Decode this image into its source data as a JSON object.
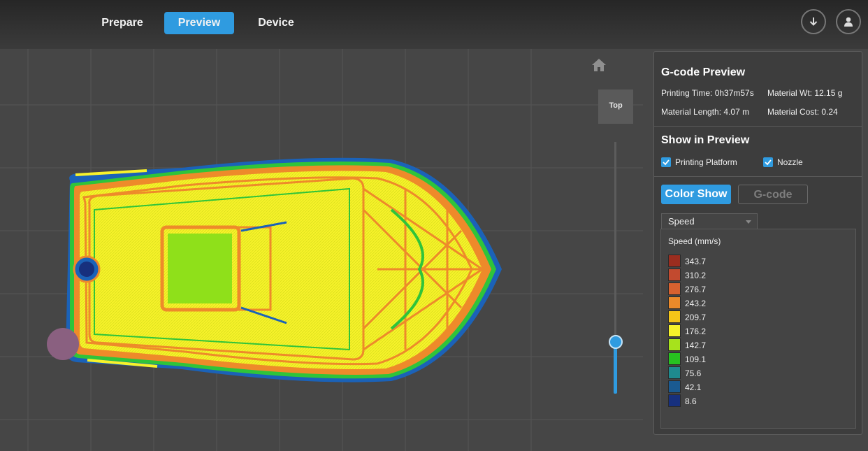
{
  "nav": {
    "tabs": [
      {
        "label": "Prepare",
        "active": false
      },
      {
        "label": "Preview",
        "active": true
      },
      {
        "label": "Device",
        "active": false
      }
    ],
    "accent": "#2f9be0"
  },
  "view": {
    "cube_label": "Top",
    "layer_slider": 0.2
  },
  "panel": {
    "title": "G-code Preview",
    "printing_time": "Printing Time: 0h37m57s",
    "material_wt": "Material Wt: 12.15 g",
    "material_length": "Material Length: 4.07 m",
    "material_cost": "Material Cost: 0.24",
    "show_title": "Show in Preview",
    "checkboxes": [
      {
        "label": "Printing Platform",
        "checked": true
      },
      {
        "label": "Nozzle",
        "checked": true
      }
    ],
    "color_show_label": "Color Show",
    "gcode_label": "G-code",
    "dropdown_value": "Speed",
    "legend_title": "Speed (mm/s)",
    "legend": [
      {
        "label": "343.7",
        "color": "#9b2d1f"
      },
      {
        "label": "310.2",
        "color": "#c24a2f"
      },
      {
        "label": "276.7",
        "color": "#d8612f"
      },
      {
        "label": "243.2",
        "color": "#ec8a2a"
      },
      {
        "label": "209.7",
        "color": "#f5c518"
      },
      {
        "label": "176.2",
        "color": "#f7f22a"
      },
      {
        "label": "142.7",
        "color": "#a7e21c"
      },
      {
        "label": "109.1",
        "color": "#27c21f"
      },
      {
        "label": "75.6",
        "color": "#1e8a8e"
      },
      {
        "label": "42.1",
        "color": "#1a5a91"
      },
      {
        "label": "8.6",
        "color": "#17307e"
      }
    ]
  }
}
